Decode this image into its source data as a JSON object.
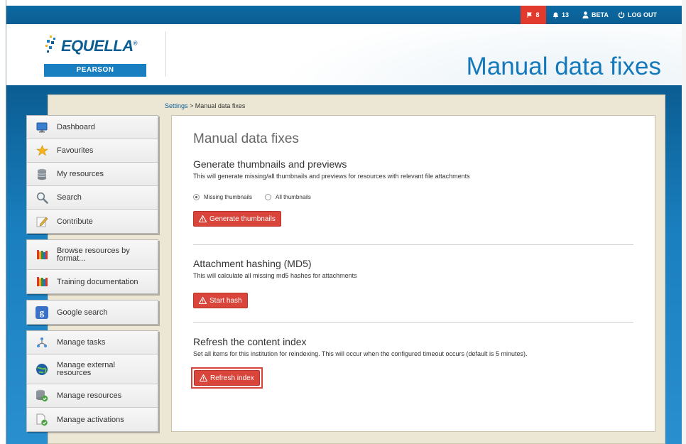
{
  "topbar": {
    "flag_count": "8",
    "notifications_count": "13",
    "user_label": "BETA",
    "logout_label": "LOG OUT"
  },
  "logo": {
    "wordmark": "EQUELLA",
    "registered": "®",
    "subbrand": "PEARSON"
  },
  "header": {
    "title": "Manual data fixes"
  },
  "breadcrumb": {
    "parent": "Settings",
    "separator": " > ",
    "current": "Manual data fixes"
  },
  "sidebar": {
    "group1": [
      {
        "label": "Dashboard",
        "icon": "monitor-icon"
      },
      {
        "label": "Favourites",
        "icon": "star-icon"
      },
      {
        "label": "My resources",
        "icon": "database-icon"
      },
      {
        "label": "Search",
        "icon": "search-icon"
      },
      {
        "label": "Contribute",
        "icon": "pencil-icon"
      }
    ],
    "group2": [
      {
        "label": "Browse resources by format...",
        "icon": "books-icon"
      },
      {
        "label": "Training documentation",
        "icon": "books-icon"
      }
    ],
    "group3": [
      {
        "label": "Google search",
        "icon": "google-icon"
      }
    ],
    "group4": [
      {
        "label": "Manage tasks",
        "icon": "workflow-icon"
      },
      {
        "label": "Manage external resources",
        "icon": "globe-icon"
      },
      {
        "label": "Manage resources",
        "icon": "database-check-icon"
      },
      {
        "label": "Manage activations",
        "icon": "document-check-icon"
      }
    ]
  },
  "panel": {
    "title": "Manual data fixes",
    "thumbnails": {
      "title": "Generate thumbnails and previews",
      "description": "This will generate missing/all thumbnails and previews for resources with relevant file attachments",
      "option_missing": "Missing thumbnails",
      "option_all": "All thumbnails",
      "selected": "Missing thumbnails",
      "button": "Generate thumbnails"
    },
    "hashing": {
      "title": "Attachment hashing (MD5)",
      "description": "This will calculate all missing md5 hashes for attachments",
      "button": "Start hash"
    },
    "reindex": {
      "title": "Refresh the content index",
      "description": "Set all items for this institution for reindexing. This will occur when the configured timeout occurs (default is 5 minutes).",
      "button": "Refresh index"
    }
  },
  "colors": {
    "brand_blue": "#0a5d92",
    "heading_blue": "#1479ba",
    "danger_red": "#d9453a",
    "alert_red": "#e23b2e"
  }
}
